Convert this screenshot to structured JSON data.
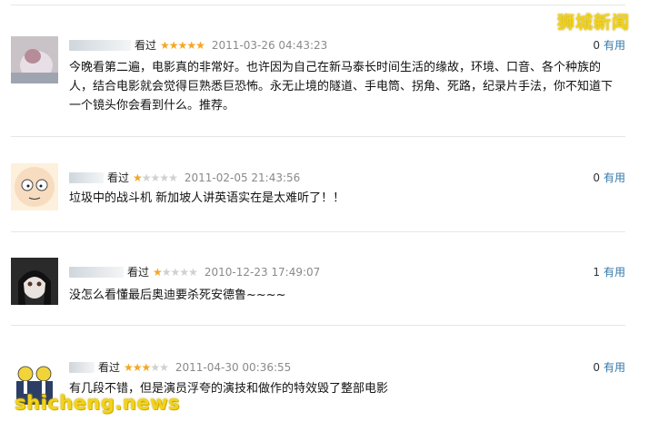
{
  "watermark": {
    "top": "狮城新闻",
    "bottom": "shicheng.news"
  },
  "colors": {
    "star": "#f5a623",
    "link": "#3377aa",
    "date": "#8a8a8a",
    "watermark": "#f2d21b"
  },
  "comments": [
    {
      "rating_label": "看过",
      "stars": 5,
      "date": "2011-03-26 04:43:23",
      "useful_count": "0",
      "useful_label": "有用",
      "text": "今晚看第二遍，电影真的非常好。也许因为自己在新马泰长时间生活的缘故，环境、口音、各个种族的人，结合电影就会觉得巨熟悉巨恐怖。永无止境的隧道、手电筒、拐角、死路，纪录片手法，你不知道下一个镜头你会看到什么。推荐。"
    },
    {
      "rating_label": "看过",
      "stars": 1,
      "date": "2011-02-05 21:43:56",
      "useful_count": "0",
      "useful_label": "有用",
      "text": "垃圾中的战斗机 新加坡人讲英语实在是太难听了！！"
    },
    {
      "rating_label": "看过",
      "stars": 1,
      "date": "2010-12-23 17:49:07",
      "useful_count": "1",
      "useful_label": "有用",
      "text": "没怎么看懂最后奥迪要杀死安德鲁~~~~"
    },
    {
      "rating_label": "看过",
      "stars": 3,
      "date": "2011-04-30 00:36:55",
      "useful_count": "0",
      "useful_label": "有用",
      "text": "有几段不错，但是演员浮夸的演技和做作的特效毁了整部电影"
    }
  ]
}
